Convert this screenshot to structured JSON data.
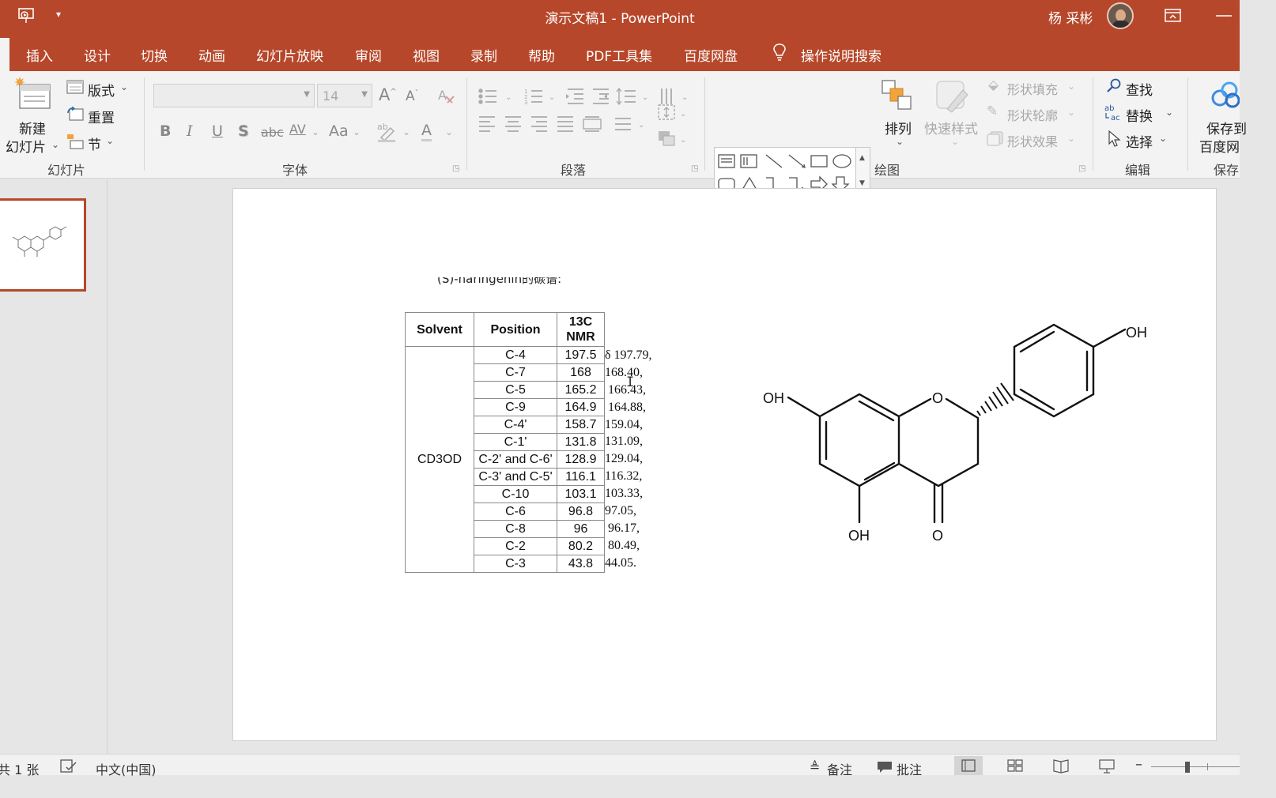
{
  "title_bar": {
    "document_title": "演示文稿1 - PowerPoint",
    "user_name": "杨 采彬",
    "quick_access_icon": "slideshow-from-start-icon",
    "customize_icon": "customize-quick-access-icon",
    "ribbon_display_icon": "ribbon-display-options-icon",
    "minimize_icon": "minimize-icon"
  },
  "tabs": [
    "插入",
    "设计",
    "切换",
    "动画",
    "幻灯片放映",
    "审阅",
    "视图",
    "录制",
    "帮助",
    "PDF工具集",
    "百度网盘"
  ],
  "tell_me": {
    "label": "操作说明搜索",
    "icon": "lightbulb-icon"
  },
  "ribbon": {
    "slides_group": {
      "label": "幻灯片",
      "new_slide_line1": "新建",
      "new_slide_line2": "幻灯片",
      "layout": "版式",
      "reset": "重置",
      "section": "节"
    },
    "font_group": {
      "label": "字体",
      "font_name": "",
      "font_size": "14",
      "bold": "B",
      "italic": "I",
      "underline": "U",
      "shadow": "S",
      "strike": "abc",
      "spacing": "AV",
      "case": "Aa",
      "color": "A"
    },
    "paragraph_group": {
      "label": "段落"
    },
    "drawing_group": {
      "label": "绘图",
      "arrange": "排列",
      "quick_styles": "快速样式",
      "shape_fill": "形状填充",
      "shape_outline": "形状轮廓",
      "shape_effects": "形状效果"
    },
    "editing_group": {
      "label": "编辑",
      "find": "查找",
      "replace": "替换",
      "select": "选择"
    },
    "save_group": {
      "label": "保存",
      "button_line1": "保存到",
      "button_line2": "百度网"
    }
  },
  "slide": {
    "caption_partial": "(S)-naringenin的碳谱:",
    "table": {
      "headers": [
        "Solvent",
        "Position",
        "13C NMR"
      ],
      "solvent": "CD3OD",
      "rows": [
        [
          "C-4",
          "197.5"
        ],
        [
          "C-7",
          "168"
        ],
        [
          "C-5",
          "165.2"
        ],
        [
          "C-9",
          "164.9"
        ],
        [
          "C-4'",
          "158.7"
        ],
        [
          "C-1'",
          "131.8"
        ],
        [
          "C-2' and C-6'",
          "128.9"
        ],
        [
          "C-3' and C-5'",
          "116.1"
        ],
        [
          "C-10",
          "103.1"
        ],
        [
          "C-6",
          "96.8"
        ],
        [
          "C-8",
          "96"
        ],
        [
          "C-2",
          "80.2"
        ],
        [
          "C-3",
          "43.8"
        ]
      ]
    },
    "literature_values": [
      "δ 197.79,",
      "168.40,",
      " 166.43,",
      " 164.88,",
      "159.04,",
      "131.09,",
      "129.04,",
      "116.32,",
      "103.33,",
      "97.05,",
      " 96.17,",
      " 80.49,",
      "44.05."
    ],
    "structure_labels": {
      "oh_left": "OH",
      "oh_right": "OH",
      "oh_bottom": "OH",
      "ring_o": "O",
      "carbonyl_o": "O"
    }
  },
  "status_bar": {
    "slide_count": "共 1 张",
    "language": "中文(中国)",
    "notes": "备注",
    "comments": "批注"
  },
  "colors": {
    "accent": "#b7472a",
    "ribbon_bg": "#f3f3f3",
    "canvas_bg": "#e6e6e6"
  }
}
